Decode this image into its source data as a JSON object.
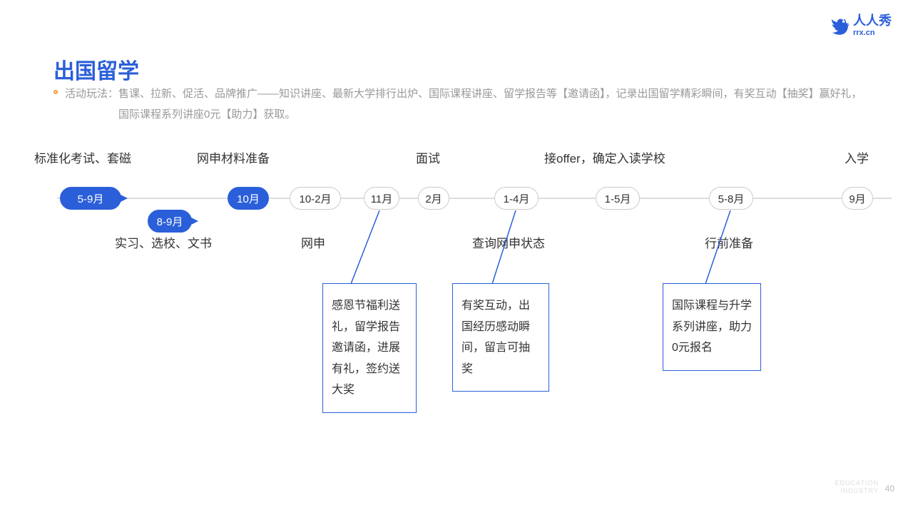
{
  "logo": {
    "main": "人人秀",
    "sub": "rrx.cn"
  },
  "title": "出国留学",
  "subtitle_label": "活动玩法：",
  "subtitle_text": "售课、拉新、促活、品牌推广——知识讲座、最新大学排行出炉、国际课程讲座、留学报告等【邀请函】，记录出国留学精彩瞬间，有奖互动【抽奖】赢好礼，国际课程系列讲座0元【助力】获取。",
  "labels_top": {
    "l1": "标准化考试、套磁",
    "l2": "网申材料准备",
    "l3": "面试",
    "l4": "接offer，确定入读学校",
    "l5": "入学"
  },
  "labels_bottom": {
    "l1": "实习、选校、文书",
    "l2": "网申",
    "l3": "查询网申状态",
    "l4": "行前准备"
  },
  "nodes": {
    "n1": "5-9月",
    "n2": "8-9月",
    "n3": "10月",
    "n4": "10-2月",
    "n5": "11月",
    "n6": "2月",
    "n7": "1-4月",
    "n8": "1-5月",
    "n9": "5-8月",
    "n10": "9月"
  },
  "callouts": {
    "c1": "感恩节福利送礼，留学报告邀请函，进展有礼，签约送大奖",
    "c2": "有奖互动，出国经历感动瞬间，留言可抽奖",
    "c3": "国际课程与升学系列讲座，助力0元报名"
  },
  "footer": {
    "line1": "EDUCATION",
    "line2": "INDUSTRY"
  },
  "page": "40"
}
